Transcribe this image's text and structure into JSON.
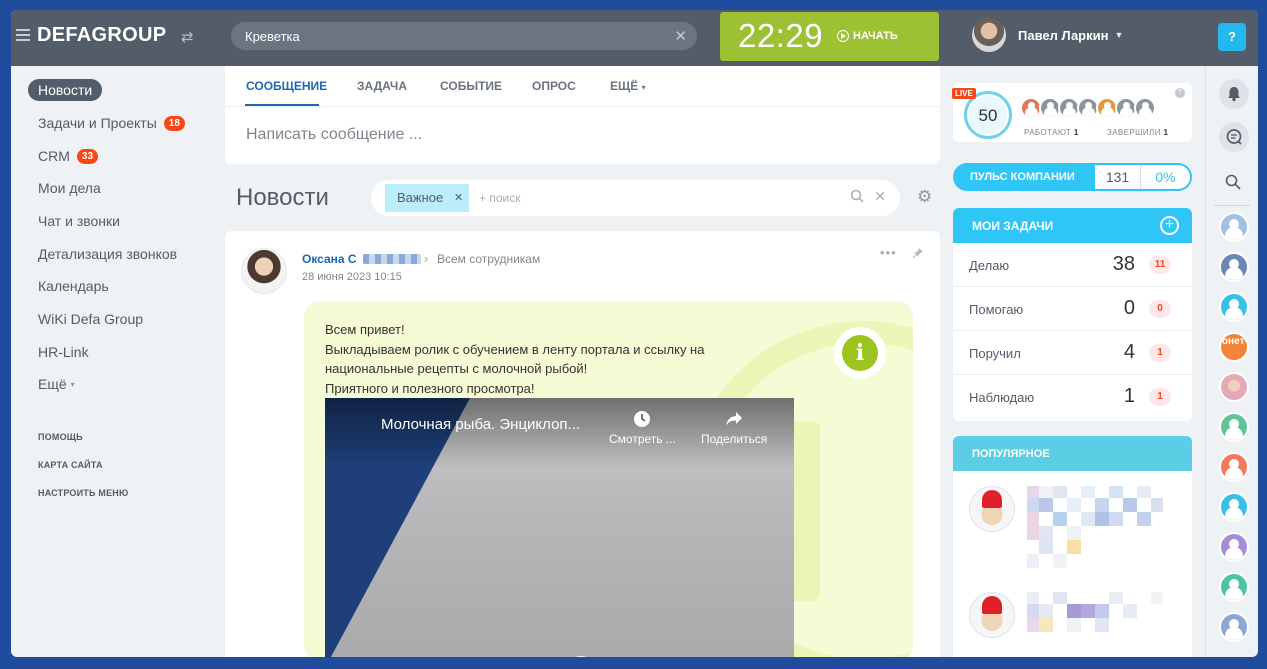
{
  "header": {
    "logo": "DEFAGROUP",
    "search_value": "Креветка",
    "timer": {
      "time": "22:29",
      "start_label": "НАЧАТЬ"
    },
    "user_name": "Павел Ларкин",
    "help_label": "?"
  },
  "left_menu": {
    "items": [
      {
        "label": "Новости",
        "active": true
      },
      {
        "label": "Задачи и Проекты",
        "badge": "18"
      },
      {
        "label": "CRM",
        "badge": "33"
      },
      {
        "label": "Мои дела"
      },
      {
        "label": "Чат и звонки"
      },
      {
        "label": "Детализация звонков"
      },
      {
        "label": "Календарь"
      },
      {
        "label": "WiKi Defa Group"
      },
      {
        "label": "HR-Link"
      },
      {
        "label": "Ещё"
      }
    ],
    "small_links": [
      "ПОМОЩЬ",
      "КАРТА САЙТА",
      "НАСТРОИТЬ МЕНЮ"
    ]
  },
  "composer": {
    "tabs": [
      "СООБЩЕНИЕ",
      "ЗАДАЧА",
      "СОБЫТИЕ",
      "ОПРОС",
      "ЕЩЁ"
    ],
    "placeholder": "Написать сообщение ..."
  },
  "feed": {
    "title": "Новости",
    "filter_tag": "Важное",
    "filter_placeholder": "+ поиск"
  },
  "post": {
    "author": "Оксана С",
    "destination": "Всем сотрудникам",
    "date": "28 июня 2023 10:15",
    "lines": [
      "Всем привет!",
      "Выкладываем ролик с обучением в ленту портала и ссылку на",
      "национальные рецепты с молочной рыбой!",
      "Приятного и полезного просмотра!"
    ],
    "video": {
      "title": "Молочная рыба. Энциклоп...",
      "watch_label": "Смотреть ...",
      "share_label": "Поделиться"
    }
  },
  "live": {
    "badge": "LIVE",
    "value": "50",
    "working_label": "РАБОТАЮТ",
    "working_count": "1",
    "done_label": "ЗАВЕРШИЛИ",
    "done_count": "1"
  },
  "pulse": {
    "label": "ПУЛЬС КОМПАНИИ",
    "count": "131",
    "percent": "0%"
  },
  "tasks": {
    "title": "МОИ ЗАДАЧИ",
    "rows": [
      {
        "label": "Делаю",
        "count": "38",
        "badge": "11"
      },
      {
        "label": "Помогаю",
        "count": "0",
        "badge": "0"
      },
      {
        "label": "Поручил",
        "count": "4",
        "badge": "1"
      },
      {
        "label": "Наблюдаю",
        "count": "1",
        "badge": "1"
      }
    ]
  },
  "popular": {
    "title": "ПОПУЛЯРНОЕ"
  },
  "rightbar": {
    "promo_text": "онет-"
  },
  "colors": {
    "header": "#535c69",
    "accent": "#2fc6f6",
    "timer": "#9dc134",
    "badge": "#f54819",
    "frame": "#1f4c9c"
  }
}
